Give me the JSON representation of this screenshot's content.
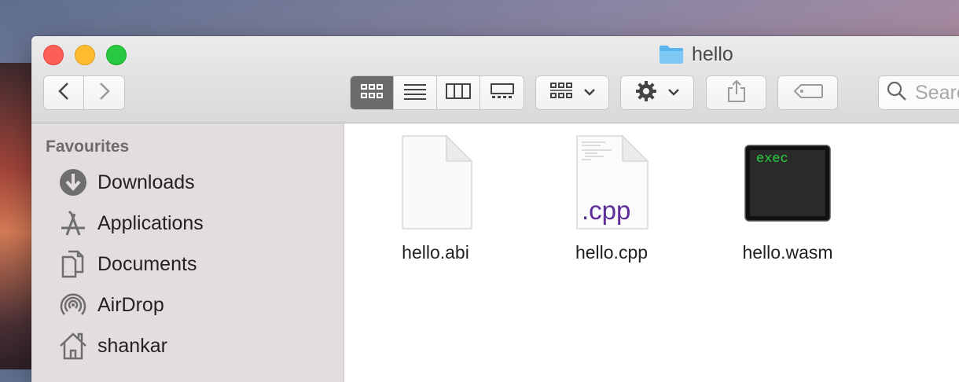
{
  "window": {
    "title": "hello",
    "folder_icon": "folder-icon"
  },
  "toolbar": {
    "back_icon": "chevron-left-icon",
    "forward_icon": "chevron-right-icon",
    "view_modes": [
      "icon-view",
      "list-view",
      "column-view",
      "cover-flow-view"
    ],
    "active_view": "icon-view",
    "arrange_icon": "arrange-grid-icon",
    "action_icon": "gear-icon",
    "share_icon": "share-icon",
    "tag_icon": "tag-icon",
    "search_placeholder": "Search"
  },
  "sidebar": {
    "heading": "Favourites",
    "items": [
      {
        "label": "Downloads",
        "icon": "download-icon"
      },
      {
        "label": "Applications",
        "icon": "applications-icon"
      },
      {
        "label": "Documents",
        "icon": "documents-icon"
      },
      {
        "label": "AirDrop",
        "icon": "airdrop-icon"
      },
      {
        "label": "shankar",
        "icon": "home-icon"
      }
    ]
  },
  "files": [
    {
      "name": "hello.abi",
      "icon": "blank-document-icon"
    },
    {
      "name": "hello.cpp",
      "icon": "cpp-document-icon",
      "badge": ".cpp",
      "badge_color": "#5b2b98"
    },
    {
      "name": "hello.wasm",
      "icon": "executable-icon",
      "exec_text": "exec",
      "exec_color": "#27d23f"
    }
  ],
  "colors": {
    "close": "#fd5e57",
    "minimize": "#febc2e",
    "maximize": "#28c840",
    "folder": "#5ab4ee"
  }
}
